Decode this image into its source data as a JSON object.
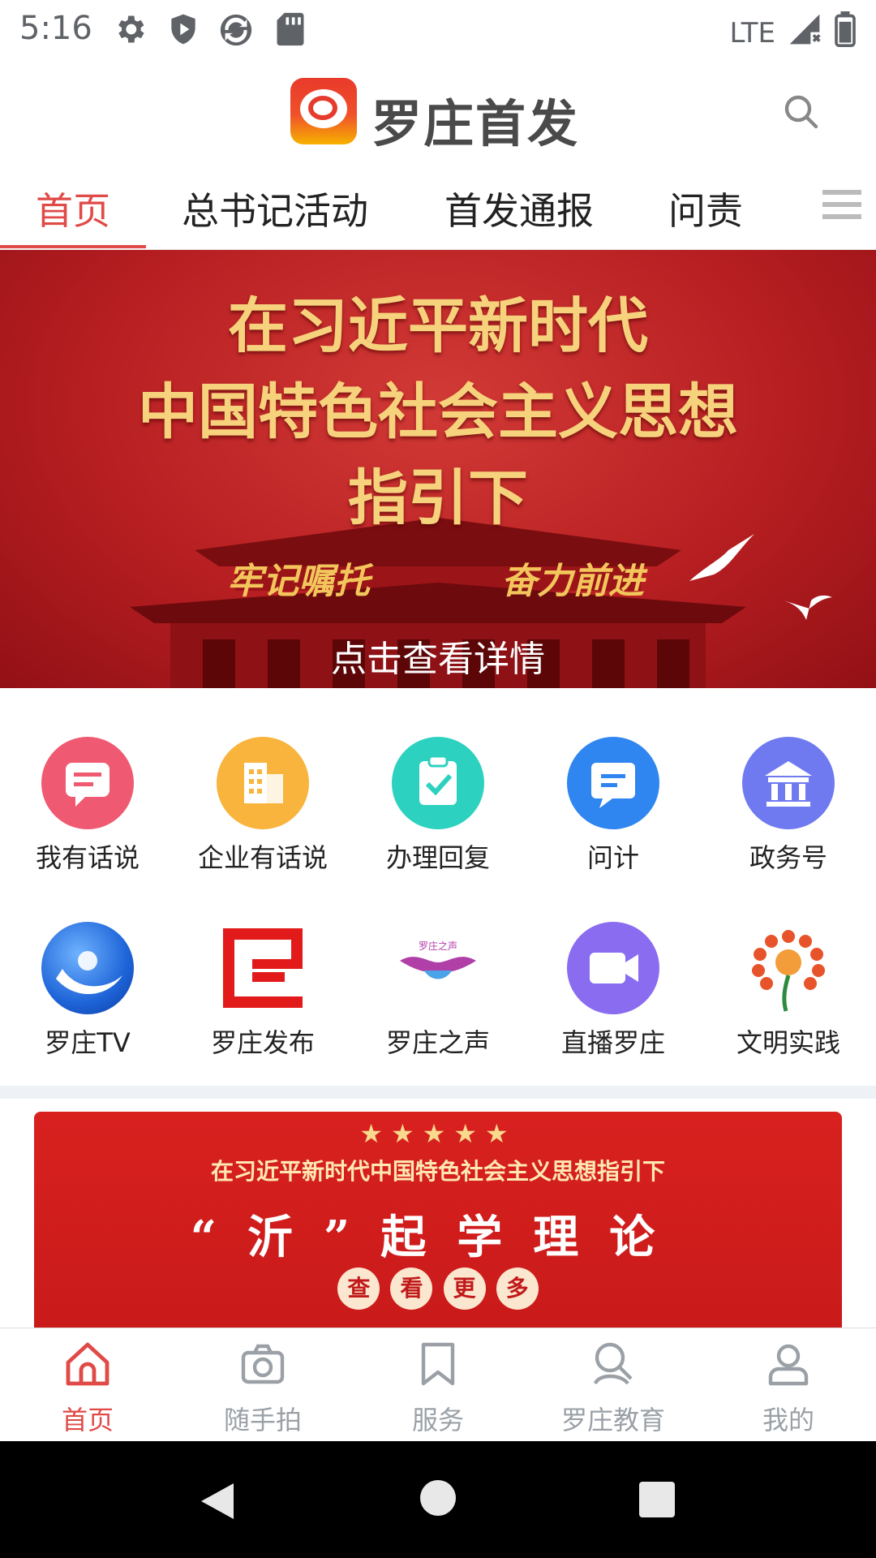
{
  "status_bar": {
    "time": "5:16",
    "network": "LTE",
    "icons": [
      "gear-icon",
      "shield-icon",
      "sync-icon",
      "sdcard-icon",
      "signal-icon",
      "battery-icon"
    ]
  },
  "header": {
    "app_title": "罗庄首发",
    "search_icon": "search-icon"
  },
  "tabs": [
    {
      "label": "首页",
      "active": true
    },
    {
      "label": "总书记活动",
      "active": false
    },
    {
      "label": "首发通报",
      "active": false
    },
    {
      "label": "问责",
      "active": false
    }
  ],
  "banner": {
    "line1": "在习近平新时代",
    "line2": "中国特色社会主义思想",
    "line3": "指引下",
    "sub_left": "牢记嘱托",
    "sub_right": "奋力前进",
    "caption": "点击查看详情"
  },
  "grid": [
    {
      "label": "我有话说",
      "icon": "chat-icon",
      "color": "#ef5a72"
    },
    {
      "label": "企业有话说",
      "icon": "building-icon",
      "color": "#f8b43c"
    },
    {
      "label": "办理回复",
      "icon": "clipboard-icon",
      "color": "#2dd1bf"
    },
    {
      "label": "问计",
      "icon": "message-icon",
      "color": "#2f86f0"
    },
    {
      "label": "政务号",
      "icon": "government-icon",
      "color": "#6f7af0"
    },
    {
      "label": "罗庄TV",
      "icon": "tv-logo-icon",
      "color": "#1e64d8"
    },
    {
      "label": "罗庄发布",
      "icon": "publish-logo-icon",
      "color": "#e21a1a"
    },
    {
      "label": "罗庄之声",
      "icon": "voice-logo-icon",
      "color": "#b040a8"
    },
    {
      "label": "直播罗庄",
      "icon": "video-icon",
      "color": "#8a6cf0"
    },
    {
      "label": "文明实践",
      "icon": "flower-icon",
      "color": "#e7542b"
    }
  ],
  "promo": {
    "stars": "★★★★★",
    "line1": "在习近平新时代中国特色社会主义思想指引下",
    "line2": "“沂”起学理论",
    "more": [
      "查",
      "看",
      "更",
      "多"
    ]
  },
  "bottom_nav": [
    {
      "label": "首页",
      "icon": "home-icon",
      "active": true
    },
    {
      "label": "随手拍",
      "icon": "camera-icon",
      "active": false
    },
    {
      "label": "服务",
      "icon": "bookmark-icon",
      "active": false
    },
    {
      "label": "罗庄教育",
      "icon": "education-icon",
      "active": false
    },
    {
      "label": "我的",
      "icon": "user-icon",
      "active": false
    }
  ],
  "colors": {
    "accent": "#e04a47",
    "text": "#222222",
    "nav_inactive": "#9aa0a6",
    "banner_red": "#b81f22"
  }
}
